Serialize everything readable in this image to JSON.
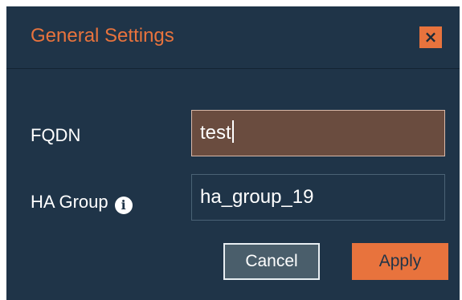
{
  "dialog": {
    "title": "General Settings",
    "close_label": "×"
  },
  "fields": {
    "fqdn": {
      "label": "FQDN",
      "value": "test"
    },
    "ha_group": {
      "label": "HA Group",
      "info_icon": "info-icon",
      "value": "ha_group_19"
    }
  },
  "buttons": {
    "cancel_label": "Cancel",
    "apply_label": "Apply"
  },
  "colors": {
    "background": "#1f3448",
    "accent": "#e8733d",
    "active_input": "#6a4c3f"
  }
}
